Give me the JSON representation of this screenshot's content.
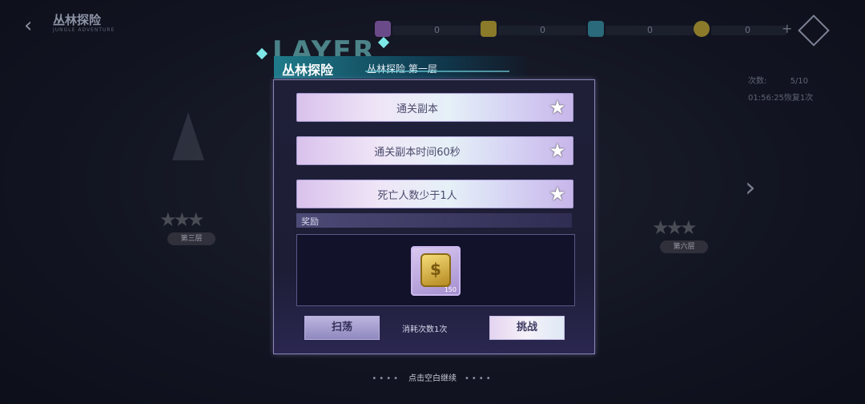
{
  "header": {
    "title": "丛林探险",
    "subtitle_en": "JUNGLE ADVENTURE",
    "resources": [
      {
        "value": "0"
      },
      {
        "value": "0"
      },
      {
        "value": "0"
      },
      {
        "value": "0"
      }
    ]
  },
  "side": {
    "left_stage": "第三层",
    "right_stage": "第六层"
  },
  "counts": {
    "times_label": "次数:",
    "times_value": "5/10",
    "timer": "01:56:25恢复1次"
  },
  "layer_deco": "LAYER",
  "dialog": {
    "title": "丛林探险",
    "subtitle": "丛林探险 第一层",
    "conditions": [
      {
        "text": "通关副本"
      },
      {
        "text": "通关副本时间60秒"
      },
      {
        "text": "死亡人数少于1人"
      }
    ],
    "reward_label": "奖励",
    "reward_item": {
      "count": "150",
      "icon": "gold-coin-card"
    },
    "sweep_label": "扫荡",
    "cost_text": "消耗次数1次",
    "challenge_label": "挑战"
  },
  "hint": "点击空白继续",
  "colors": {
    "accent": "#7ee8e8",
    "panel_border": "#8b86b8"
  }
}
